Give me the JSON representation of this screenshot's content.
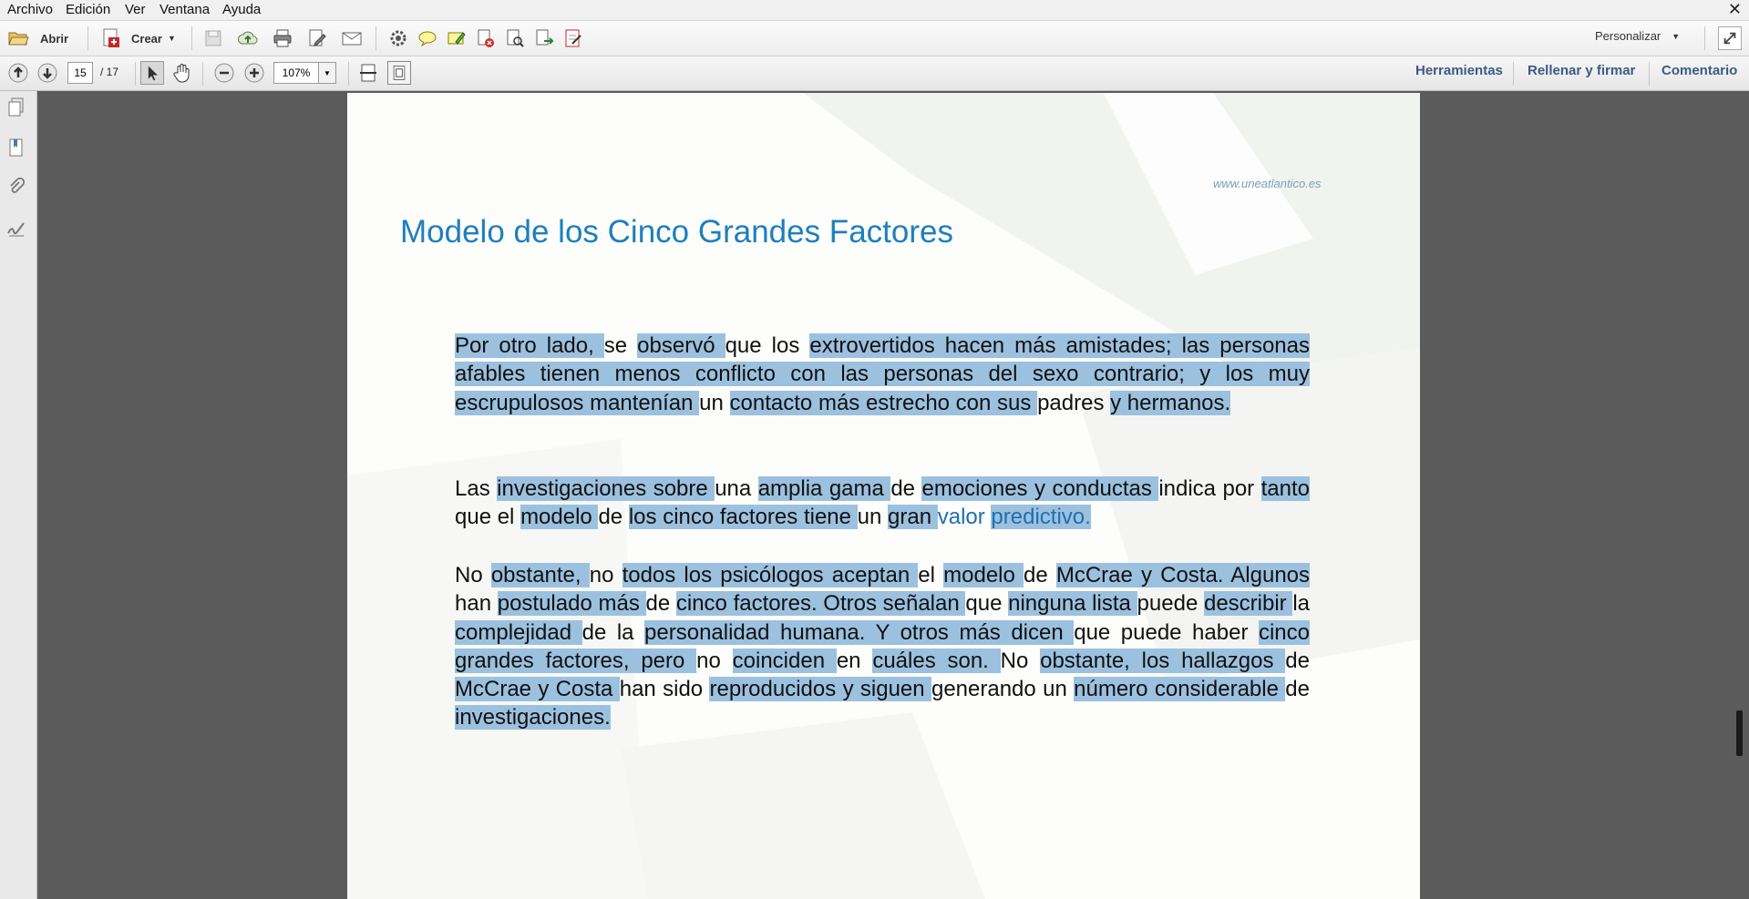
{
  "menu": [
    "Archivo",
    "Edición",
    "Ver",
    "Ventana",
    "Ayuda"
  ],
  "toolbar": {
    "open_label": "Abrir",
    "create_label": "Crear",
    "customize_label": "Personalizar"
  },
  "nav": {
    "current_page": "15",
    "total_pages": "/ 17",
    "zoom": "107%"
  },
  "panels": {
    "tools": "Herramientas",
    "fill_sign": "Rellenar y firmar",
    "comment": "Comentario"
  },
  "document": {
    "watermark": "www.uneatlantico.es",
    "title": "Modelo de los Cinco Grandes Factores",
    "paragraphs": [
      [
        {
          "t": "Por otro lado, ",
          "h": true
        },
        {
          "t": "se "
        },
        {
          "t": "observó ",
          "h": true
        },
        {
          "t": "que "
        },
        {
          "t": "los "
        },
        {
          "t": "extrovertidos hacen más amistades; las personas afables tienen menos conflicto con las personas del sexo contrario; y los muy escrupulosos mantenían ",
          "h": true
        },
        {
          "t": "un "
        },
        {
          "t": "contacto ",
          "h": true
        },
        {
          "t": "más estrecho con sus ",
          "h": true
        },
        {
          "t": "padres "
        },
        {
          "t": "y hermanos.",
          "h": true
        }
      ],
      [
        {
          "t": "Las "
        },
        {
          "t": "investigaciones sobre ",
          "h": true
        },
        {
          "t": "una "
        },
        {
          "t": "amplia gama ",
          "h": true
        },
        {
          "t": "de "
        },
        {
          "t": "emociones y conductas ",
          "h": true
        },
        {
          "t": "indica "
        },
        {
          "t": "por "
        },
        {
          "t": "tanto ",
          "h": true
        },
        {
          "t": "que el "
        },
        {
          "t": "modelo ",
          "h": true
        },
        {
          "t": "de "
        },
        {
          "t": "los ",
          "h": true
        },
        {
          "t": "cinco ",
          "h": true
        },
        {
          "t": "factores ",
          "h": true
        },
        {
          "t": "tiene ",
          "h": true
        },
        {
          "t": "un "
        },
        {
          "t": "gran ",
          "h": true
        },
        {
          "t": "valor ",
          "b": true
        },
        {
          "t": "predictivo.",
          "h": true,
          "b": true
        }
      ],
      [
        {
          "t": "No "
        },
        {
          "t": "obstante, ",
          "h": true
        },
        {
          "t": "no "
        },
        {
          "t": "todos los psicólogos aceptan ",
          "h": true
        },
        {
          "t": "el "
        },
        {
          "t": "modelo ",
          "h": true
        },
        {
          "t": "de "
        },
        {
          "t": "McCrae y Costa. Algunos ",
          "h": true
        },
        {
          "t": "han "
        },
        {
          "t": "postulado más ",
          "h": true
        },
        {
          "t": "de "
        },
        {
          "t": "cinco factores. Otros señalan ",
          "h": true
        },
        {
          "t": "que "
        },
        {
          "t": "ninguna lista ",
          "h": true
        },
        {
          "t": "puede "
        },
        {
          "t": "describir ",
          "h": true
        },
        {
          "t": "la "
        },
        {
          "t": "complejidad ",
          "h": true
        },
        {
          "t": "de la "
        },
        {
          "t": "personalidad humana. Y otros más dicen ",
          "h": true
        },
        {
          "t": "que puede haber "
        },
        {
          "t": "cinco grandes factores, pero ",
          "h": true
        },
        {
          "t": "no "
        },
        {
          "t": "coinciden ",
          "h": true
        },
        {
          "t": "en "
        },
        {
          "t": "cuáles son. ",
          "h": true
        },
        {
          "t": "No "
        },
        {
          "t": "obstante, los hallazgos ",
          "h": true
        },
        {
          "t": "de "
        },
        {
          "t": "McCrae y Costa ",
          "h": true
        },
        {
          "t": "han "
        },
        {
          "t": "sido "
        },
        {
          "t": "reproducidos y siguen ",
          "h": true
        },
        {
          "t": "generando "
        },
        {
          "t": "un "
        },
        {
          "t": "número considerable ",
          "h": true
        },
        {
          "t": "de "
        },
        {
          "t": "investigaciones.",
          "h": true
        }
      ]
    ]
  },
  "colors": {
    "title": "#1e7fbd",
    "highlight": "#9bc1df",
    "link_blue": "#1f6fae",
    "panel_links": "#3d5a84"
  }
}
